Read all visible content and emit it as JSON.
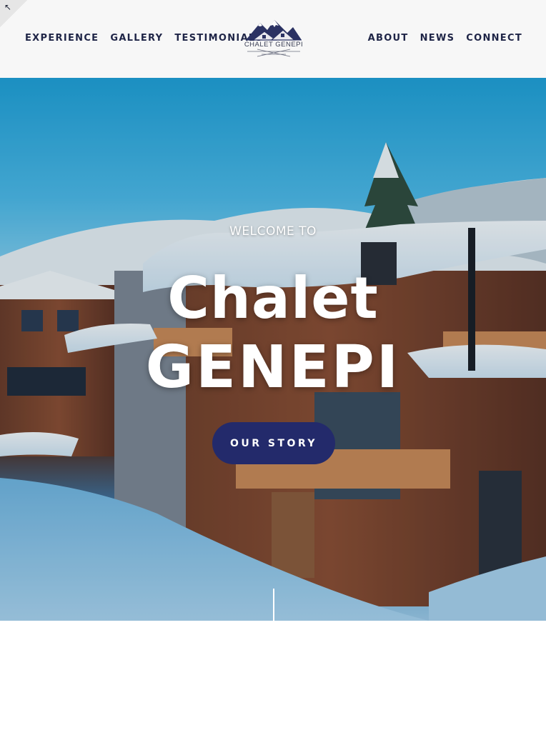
{
  "corner": {
    "icon": "arrow-up-left-icon",
    "glyph": "↖"
  },
  "header": {
    "nav_left": [
      {
        "label": "EXPERIENCE"
      },
      {
        "label": "GALLERY"
      },
      {
        "label": "TESTIMONIALS"
      }
    ],
    "nav_right": [
      {
        "label": "ABOUT"
      },
      {
        "label": "NEWS"
      },
      {
        "label": "CONNECT"
      }
    ],
    "logo_text": "CHALET GENEPI"
  },
  "hero": {
    "welcome": "WELCOME TO",
    "title_line1": "Chalet",
    "title_line2": "GENEPI",
    "cta_label": "OUR STORY",
    "cta_color": "#232a6b"
  },
  "colors": {
    "nav_text": "#1f2547",
    "header_bg": "#f7f7f7"
  }
}
